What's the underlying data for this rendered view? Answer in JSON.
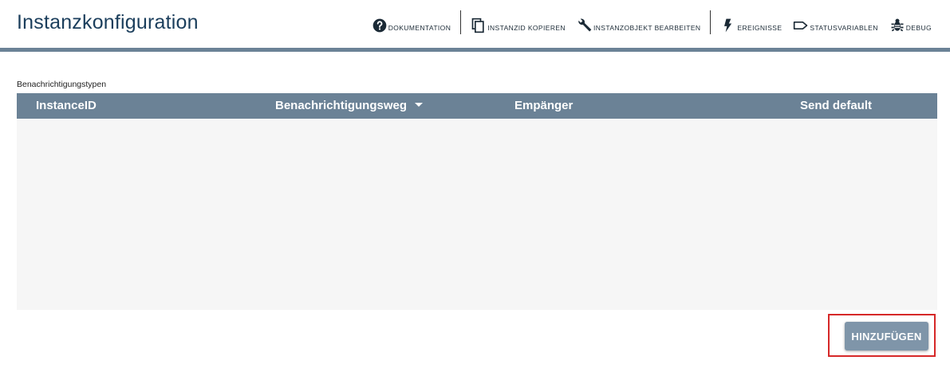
{
  "header": {
    "title": "Instanzkonfiguration"
  },
  "toolbar": [
    {
      "label": "Dokumentation",
      "icon": "help-circle-icon"
    },
    {
      "label": "InstanzID kopieren",
      "icon": "copy-icon"
    },
    {
      "label": "Instanzobjekt bearbeiten",
      "icon": "wrench-icon"
    },
    {
      "label": "Ereignisse",
      "icon": "lightning-icon"
    },
    {
      "label": "Statusvariablen",
      "icon": "tag-icon"
    },
    {
      "label": "Debug",
      "icon": "bug-icon"
    }
  ],
  "section": {
    "label": "Benachrichtigungstypen"
  },
  "table": {
    "columns": [
      {
        "label": "InstanceID",
        "sorted": false
      },
      {
        "label": "Benachrichtigungsweg",
        "sorted": true
      },
      {
        "label": "Empänger",
        "sorted": false
      },
      {
        "label": "Send default",
        "sorted": false
      }
    ],
    "rows": []
  },
  "actions": {
    "add_label": "HINZUFÜGEN"
  },
  "colors": {
    "accent": "#6b8296",
    "button": "#7f95a9",
    "highlight": "#d62828",
    "table_bg": "#f6f6f6",
    "title": "#1b3e5c"
  }
}
